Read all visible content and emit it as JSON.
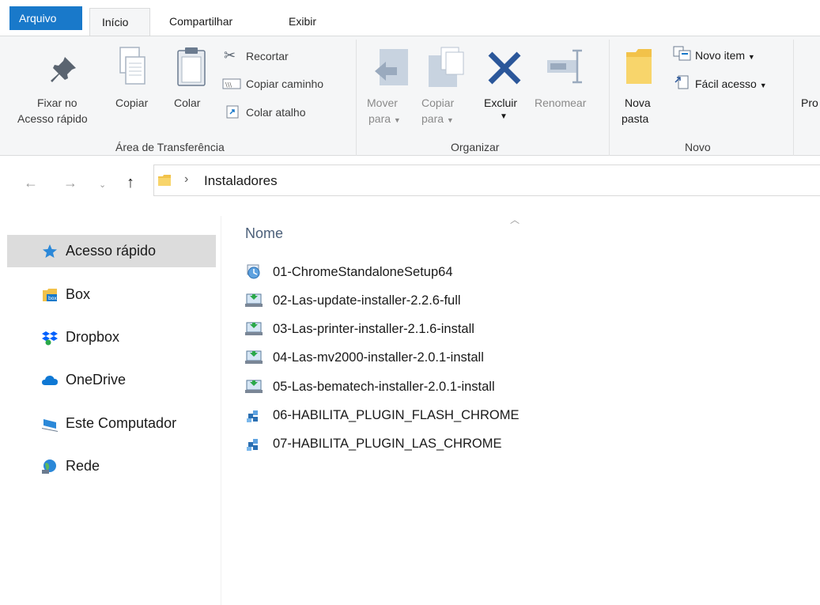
{
  "ribbon": {
    "tabs": [
      "Arquivo",
      "Início",
      "Compartilhar",
      "Exibir"
    ],
    "clipboard": {
      "pin_line1": "Fixar no",
      "pin_line2": "Acesso rápido",
      "copy": "Copiar",
      "paste": "Colar",
      "cut": "Recortar",
      "copy_path": "Copiar caminho",
      "paste_shortcut": "Colar atalho",
      "label": "Área de Transferência"
    },
    "organize": {
      "move_line1": "Mover",
      "move_line2": "para",
      "copyto_line1": "Copiar",
      "copyto_line2": "para",
      "delete": "Excluir",
      "rename": "Renomear",
      "label": "Organizar"
    },
    "new": {
      "folder_line1": "Nova",
      "folder_line2": "pasta",
      "new_item": "Novo item",
      "easy_access": "Fácil acesso",
      "label": "Novo"
    },
    "properties_partial": "Pro"
  },
  "address": {
    "current_folder": "Instaladores",
    "separator": "›"
  },
  "nav_pane": {
    "items": [
      {
        "label": "Acesso rápido",
        "icon": "star-icon"
      },
      {
        "label": "Box",
        "icon": "box-folder-icon"
      },
      {
        "label": "Dropbox",
        "icon": "dropbox-icon"
      },
      {
        "label": "OneDrive",
        "icon": "onedrive-cloud-icon"
      },
      {
        "label": "Este Computador",
        "icon": "computer-icon"
      },
      {
        "label": "Rede",
        "icon": "network-icon"
      }
    ]
  },
  "file_list": {
    "column_name": "Nome",
    "files": [
      {
        "name": "01-ChromeStandaloneSetup64",
        "icon": "setup-exe-icon"
      },
      {
        "name": "02-Las-update-installer-2.2.6-full",
        "icon": "installer-icon"
      },
      {
        "name": "03-Las-printer-installer-2.1.6-install",
        "icon": "installer-icon"
      },
      {
        "name": "04-Las-mv2000-installer-2.0.1-install",
        "icon": "installer-icon"
      },
      {
        "name": "05-Las-bematech-installer-2.0.1-install",
        "icon": "installer-icon"
      },
      {
        "name": "06-HABILITA_PLUGIN_FLASH_CHROME",
        "icon": "registry-file-icon"
      },
      {
        "name": "07-HABILITA_PLUGIN_LAS_CHROME",
        "icon": "registry-file-icon"
      }
    ]
  },
  "colors": {
    "file_tab_bg": "#1979ca",
    "ribbon_bg": "#f5f6f7",
    "selected_nav": "#dcdcdc",
    "header_text": "#4c607a",
    "delete_x": "#2b579a"
  }
}
